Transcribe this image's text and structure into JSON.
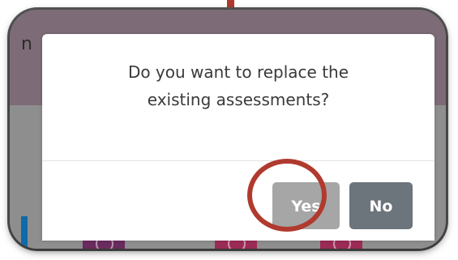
{
  "dialog": {
    "question_line1": "Do you want to replace the",
    "question_line2": "existing assessments?",
    "yes_label": "Yes",
    "no_label": "No"
  },
  "background": {
    "partial_letter": "n"
  },
  "colors": {
    "annotation": "#b03a2e",
    "yes_button": "#a6a6a6",
    "no_button": "#6c747c",
    "header_bg": "#7d6c77"
  }
}
